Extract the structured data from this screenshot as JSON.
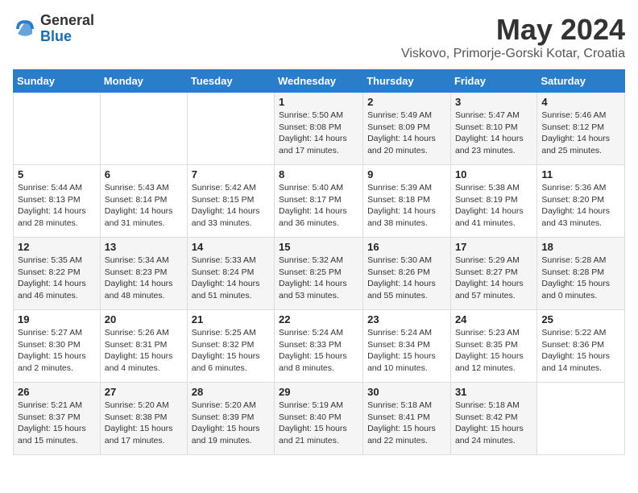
{
  "header": {
    "logo_general": "General",
    "logo_blue": "Blue",
    "title": "May 2024",
    "subtitle": "Viskovo, Primorje-Gorski Kotar, Croatia"
  },
  "days_of_week": [
    "Sunday",
    "Monday",
    "Tuesday",
    "Wednesday",
    "Thursday",
    "Friday",
    "Saturday"
  ],
  "weeks": [
    [
      {
        "day": "",
        "info": ""
      },
      {
        "day": "",
        "info": ""
      },
      {
        "day": "",
        "info": ""
      },
      {
        "day": "1",
        "info": "Sunrise: 5:50 AM\nSunset: 8:08 PM\nDaylight: 14 hours\nand 17 minutes."
      },
      {
        "day": "2",
        "info": "Sunrise: 5:49 AM\nSunset: 8:09 PM\nDaylight: 14 hours\nand 20 minutes."
      },
      {
        "day": "3",
        "info": "Sunrise: 5:47 AM\nSunset: 8:10 PM\nDaylight: 14 hours\nand 23 minutes."
      },
      {
        "day": "4",
        "info": "Sunrise: 5:46 AM\nSunset: 8:12 PM\nDaylight: 14 hours\nand 25 minutes."
      }
    ],
    [
      {
        "day": "5",
        "info": "Sunrise: 5:44 AM\nSunset: 8:13 PM\nDaylight: 14 hours\nand 28 minutes."
      },
      {
        "day": "6",
        "info": "Sunrise: 5:43 AM\nSunset: 8:14 PM\nDaylight: 14 hours\nand 31 minutes."
      },
      {
        "day": "7",
        "info": "Sunrise: 5:42 AM\nSunset: 8:15 PM\nDaylight: 14 hours\nand 33 minutes."
      },
      {
        "day": "8",
        "info": "Sunrise: 5:40 AM\nSunset: 8:17 PM\nDaylight: 14 hours\nand 36 minutes."
      },
      {
        "day": "9",
        "info": "Sunrise: 5:39 AM\nSunset: 8:18 PM\nDaylight: 14 hours\nand 38 minutes."
      },
      {
        "day": "10",
        "info": "Sunrise: 5:38 AM\nSunset: 8:19 PM\nDaylight: 14 hours\nand 41 minutes."
      },
      {
        "day": "11",
        "info": "Sunrise: 5:36 AM\nSunset: 8:20 PM\nDaylight: 14 hours\nand 43 minutes."
      }
    ],
    [
      {
        "day": "12",
        "info": "Sunrise: 5:35 AM\nSunset: 8:22 PM\nDaylight: 14 hours\nand 46 minutes."
      },
      {
        "day": "13",
        "info": "Sunrise: 5:34 AM\nSunset: 8:23 PM\nDaylight: 14 hours\nand 48 minutes."
      },
      {
        "day": "14",
        "info": "Sunrise: 5:33 AM\nSunset: 8:24 PM\nDaylight: 14 hours\nand 51 minutes."
      },
      {
        "day": "15",
        "info": "Sunrise: 5:32 AM\nSunset: 8:25 PM\nDaylight: 14 hours\nand 53 minutes."
      },
      {
        "day": "16",
        "info": "Sunrise: 5:30 AM\nSunset: 8:26 PM\nDaylight: 14 hours\nand 55 minutes."
      },
      {
        "day": "17",
        "info": "Sunrise: 5:29 AM\nSunset: 8:27 PM\nDaylight: 14 hours\nand 57 minutes."
      },
      {
        "day": "18",
        "info": "Sunrise: 5:28 AM\nSunset: 8:28 PM\nDaylight: 15 hours\nand 0 minutes."
      }
    ],
    [
      {
        "day": "19",
        "info": "Sunrise: 5:27 AM\nSunset: 8:30 PM\nDaylight: 15 hours\nand 2 minutes."
      },
      {
        "day": "20",
        "info": "Sunrise: 5:26 AM\nSunset: 8:31 PM\nDaylight: 15 hours\nand 4 minutes."
      },
      {
        "day": "21",
        "info": "Sunrise: 5:25 AM\nSunset: 8:32 PM\nDaylight: 15 hours\nand 6 minutes."
      },
      {
        "day": "22",
        "info": "Sunrise: 5:24 AM\nSunset: 8:33 PM\nDaylight: 15 hours\nand 8 minutes."
      },
      {
        "day": "23",
        "info": "Sunrise: 5:24 AM\nSunset: 8:34 PM\nDaylight: 15 hours\nand 10 minutes."
      },
      {
        "day": "24",
        "info": "Sunrise: 5:23 AM\nSunset: 8:35 PM\nDaylight: 15 hours\nand 12 minutes."
      },
      {
        "day": "25",
        "info": "Sunrise: 5:22 AM\nSunset: 8:36 PM\nDaylight: 15 hours\nand 14 minutes."
      }
    ],
    [
      {
        "day": "26",
        "info": "Sunrise: 5:21 AM\nSunset: 8:37 PM\nDaylight: 15 hours\nand 15 minutes."
      },
      {
        "day": "27",
        "info": "Sunrise: 5:20 AM\nSunset: 8:38 PM\nDaylight: 15 hours\nand 17 minutes."
      },
      {
        "day": "28",
        "info": "Sunrise: 5:20 AM\nSunset: 8:39 PM\nDaylight: 15 hours\nand 19 minutes."
      },
      {
        "day": "29",
        "info": "Sunrise: 5:19 AM\nSunset: 8:40 PM\nDaylight: 15 hours\nand 21 minutes."
      },
      {
        "day": "30",
        "info": "Sunrise: 5:18 AM\nSunset: 8:41 PM\nDaylight: 15 hours\nand 22 minutes."
      },
      {
        "day": "31",
        "info": "Sunrise: 5:18 AM\nSunset: 8:42 PM\nDaylight: 15 hours\nand 24 minutes."
      },
      {
        "day": "",
        "info": ""
      }
    ]
  ]
}
